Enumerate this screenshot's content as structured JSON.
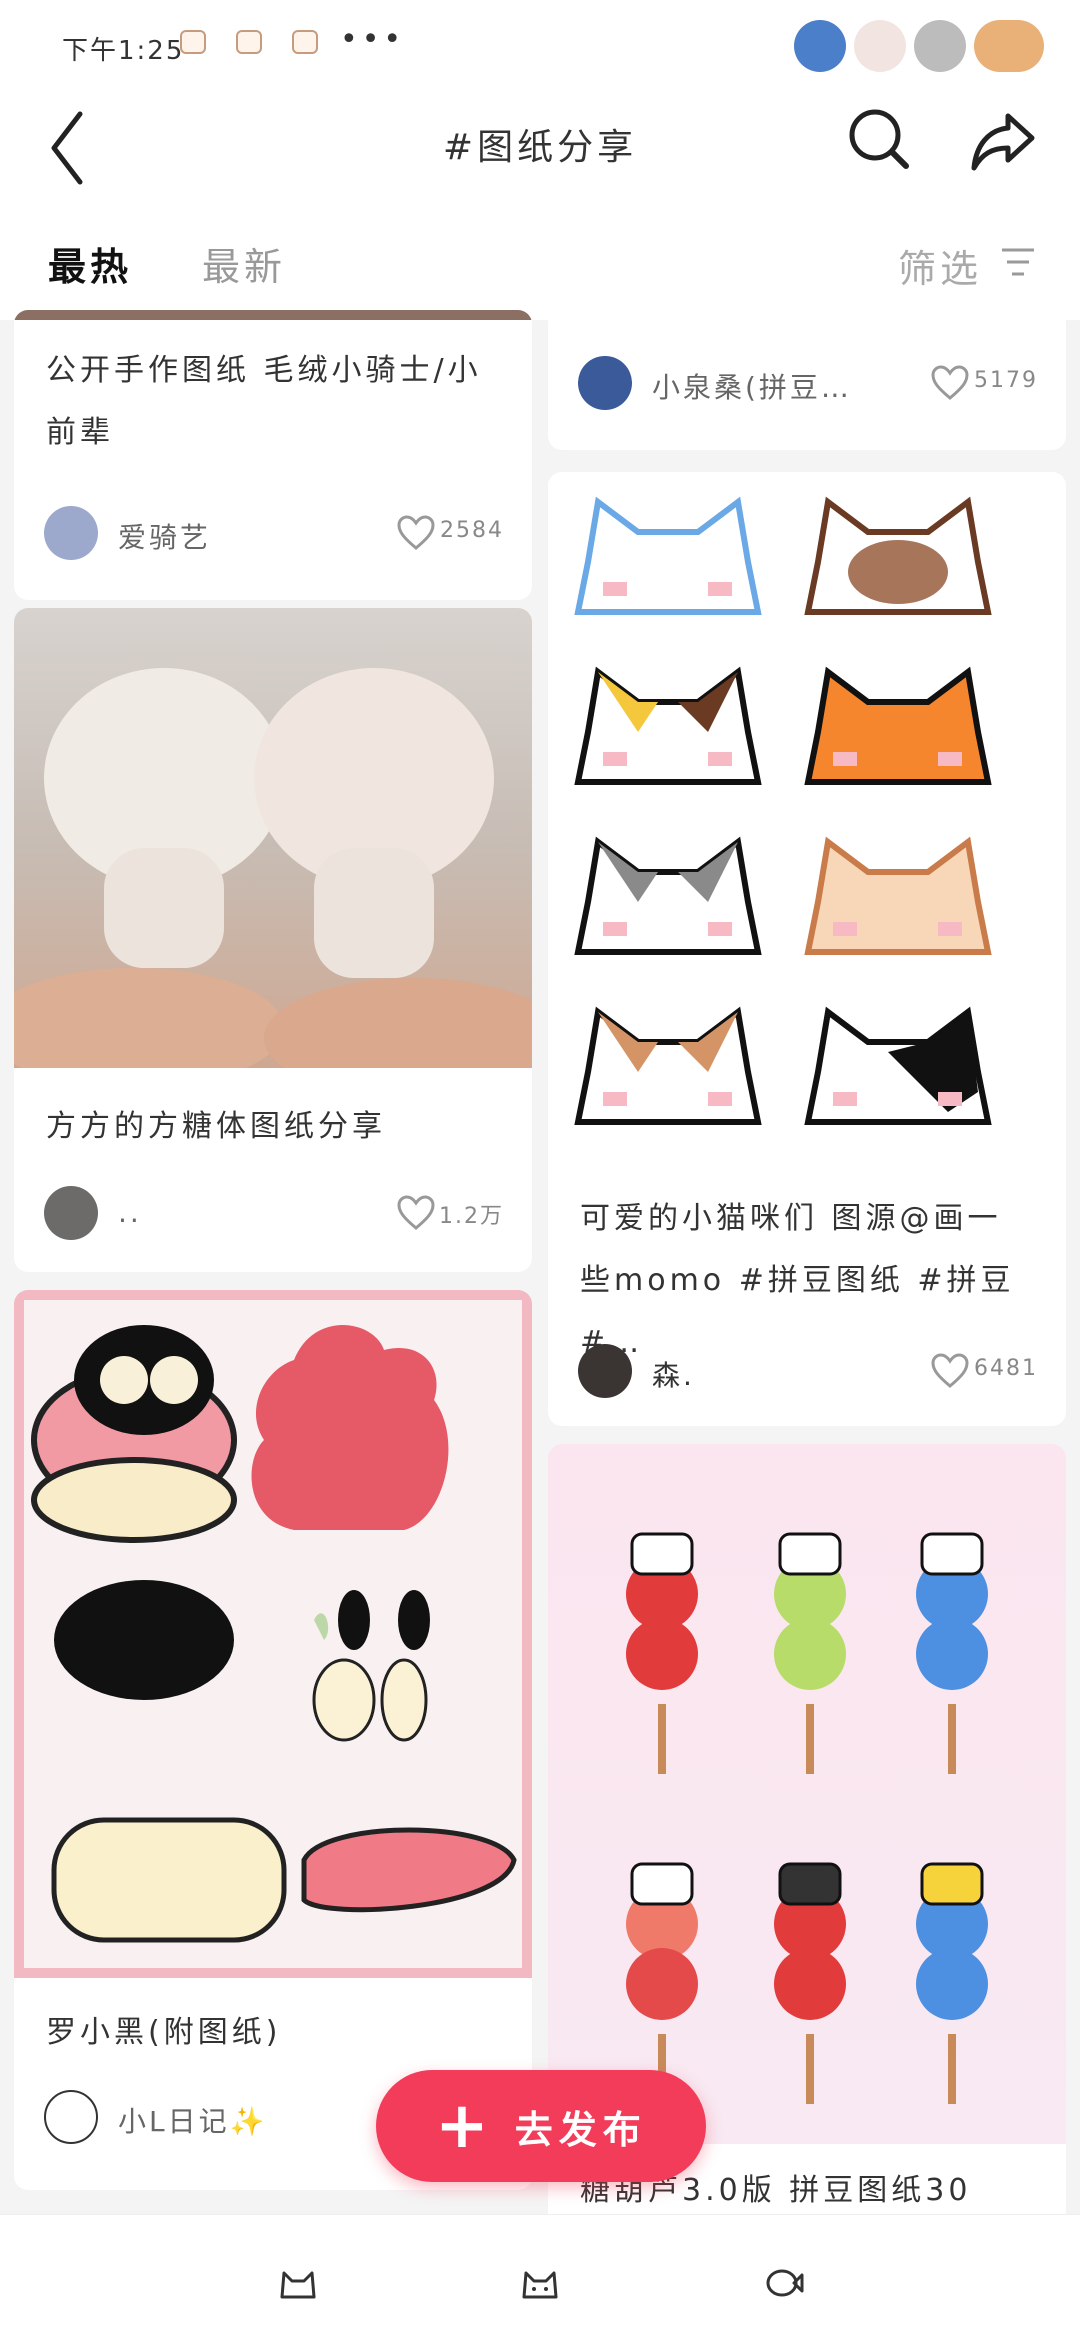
{
  "status": {
    "time": "下午1:25",
    "more": "•••"
  },
  "nav": {
    "title": "#图纸分享"
  },
  "tabs": [
    {
      "label": "最热"
    },
    {
      "label": "最新"
    }
  ],
  "filter": {
    "label": "筛选"
  },
  "feed": {
    "left": [
      {
        "caption": "公开手作图纸 毛绒小骑士/小前辈",
        "user": "爱骑艺",
        "likes": "2584"
      },
      {
        "caption": "方方的方糖体图纸分享",
        "user": "..",
        "likes": "1.2万"
      },
      {
        "caption": "罗小黑(附图纸)",
        "user": "小L日记✨",
        "likes": ""
      }
    ],
    "right": [
      {
        "caption": "",
        "user": "小泉桑(拼豆…",
        "likes": "5179"
      },
      {
        "caption": "可爱的小猫咪们 图源@画一些momo #拼豆图纸 #拼豆 #…",
        "user": "森.",
        "likes": "6481"
      },
      {
        "caption": "糖葫芦3.0版 拼豆图纸30",
        "user": "",
        "likes": ""
      }
    ]
  },
  "publish": {
    "label": "去发布",
    "plus": "+"
  },
  "colors": {
    "accent": "#f23c5a"
  }
}
